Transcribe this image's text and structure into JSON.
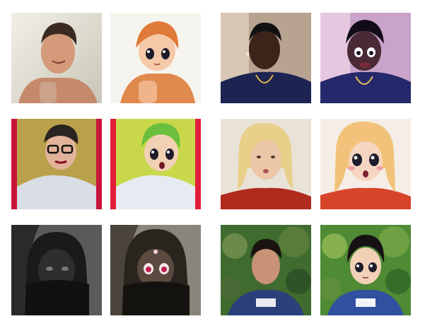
{
  "grid": {
    "pairs": [
      {
        "photo": "selfie-shirtless-man-peace-sign",
        "anime": "anime-style-shirtless-man-peace-sign"
      },
      {
        "photo": "selfie-man-dark-shirt-chain",
        "anime": "anime-style-man-dark-shirt-chain"
      },
      {
        "photo": "selfie-man-glasses-red-lips",
        "anime": "anime-style-man-green-hair"
      },
      {
        "photo": "selfie-blonde-woman-pout",
        "anime": "anime-style-blonde-woman-pout"
      },
      {
        "photo": "selfie-woman-dark-bw-covered-face",
        "anime": "anime-style-woman-dark-covered-face"
      },
      {
        "photo": "selfie-man-blue-shirt-foliage",
        "anime": "anime-style-man-blue-shirt-foliage"
      }
    ]
  },
  "colors": {
    "background": "#ffffff",
    "pink_border": "#c8143a",
    "foliage": "#3f6b2e",
    "blue_shirt": "#2b3f7a",
    "navy_shirt": "#1d2452"
  }
}
